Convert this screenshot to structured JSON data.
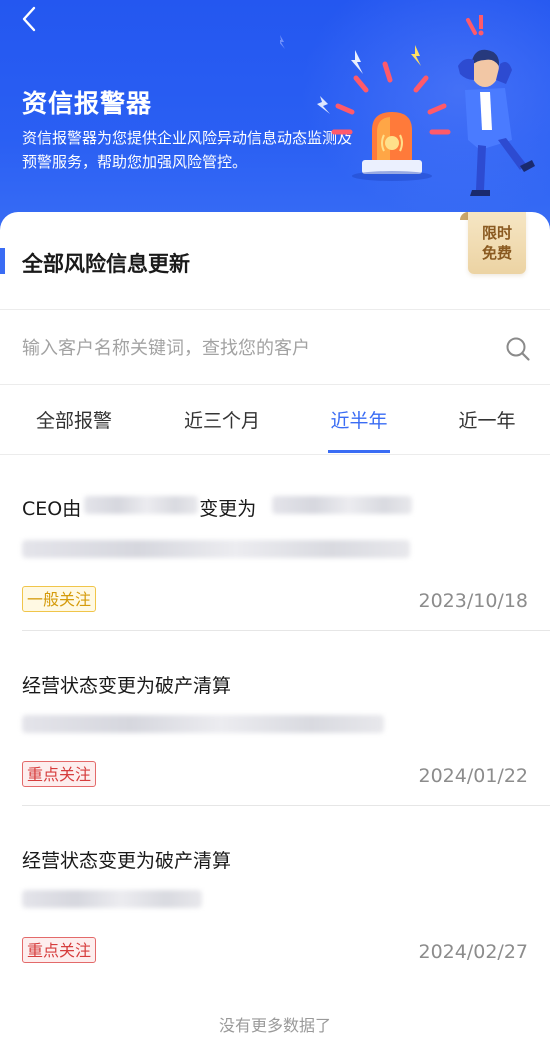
{
  "header": {
    "title": "资信报警器",
    "description": "资信报警器为您提供企业风险异动信息动态监测及预警服务，帮助您加强风险管控。"
  },
  "section": {
    "title": "全部风险信息更新",
    "promo_badge": "限时免费"
  },
  "search": {
    "placeholder": "输入客户名称关键词，查找您的客户",
    "value": ""
  },
  "tabs": [
    {
      "label": "全部报警",
      "active": false
    },
    {
      "label": "近三个月",
      "active": false
    },
    {
      "label": "近半年",
      "active": true
    },
    {
      "label": "近一年",
      "active": false
    }
  ],
  "alerts": [
    {
      "title_prefix": "CEO由",
      "title_mid": "变更为",
      "tag": "一般关注",
      "tag_level": "normal",
      "date": "2023/10/18"
    },
    {
      "title": "经营状态变更为破产清算",
      "tag": "重点关注",
      "tag_level": "important",
      "date": "2024/01/22"
    },
    {
      "title": "经营状态变更为破产清算",
      "tag": "重点关注",
      "tag_level": "important",
      "date": "2024/02/27"
    }
  ],
  "footer": {
    "no_more_text": "没有更多数据了"
  },
  "colors": {
    "primary": "#3a6cf4",
    "hero_bg": "#2a5ff3",
    "tag_normal": "#d59b0b",
    "tag_important": "#d63d3d"
  }
}
